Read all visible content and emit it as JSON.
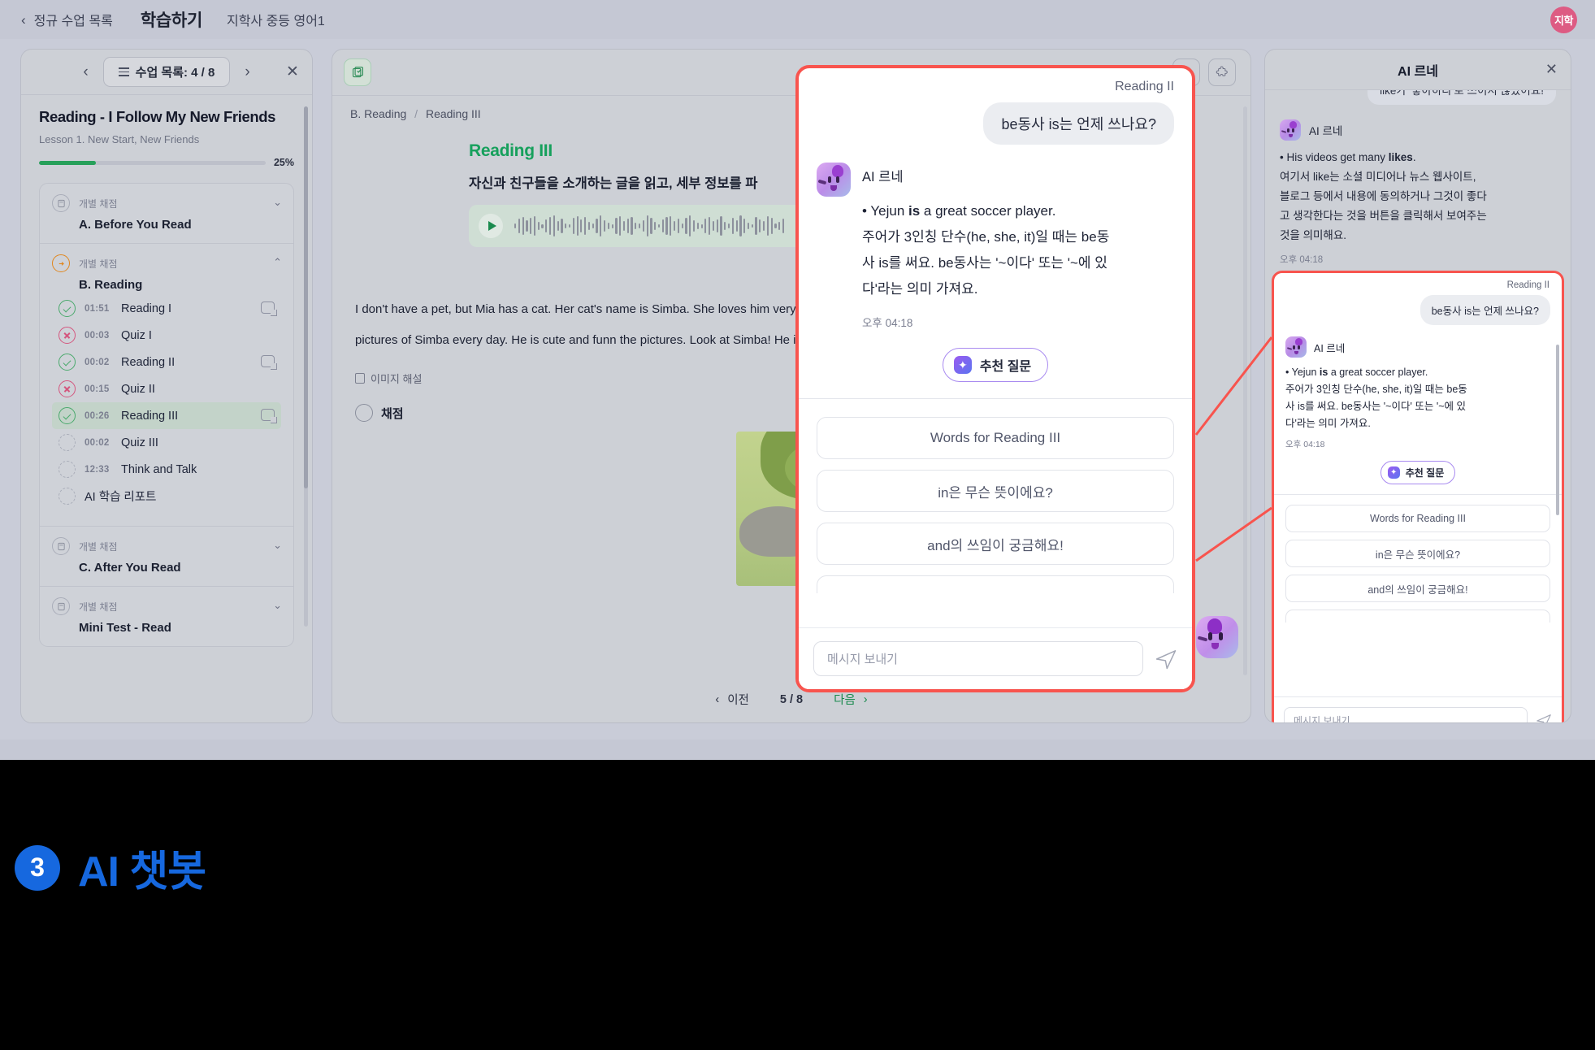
{
  "topbar": {
    "back_label": "정규 수업 목록",
    "back_icon": "chevron-left-icon",
    "title": "학습하기",
    "subtitle": "지학사 중등 영어1",
    "avatar_label": "지학"
  },
  "lesson_panel": {
    "prev_icon": "chevron-left-icon",
    "next_icon": "chevron-right-icon",
    "close_icon": "close-icon",
    "list_chip": "수업 목록: 4 / 8",
    "title": "Reading - I Follow My New Friends",
    "lesson": "Lesson 1. New Start, New Friends",
    "progress_percent": "25%",
    "progress_value": 25,
    "sections": [
      {
        "tag": "개별 채점",
        "name": "A. Before You Read",
        "icon": "clipboard-icon",
        "expanded": false
      },
      {
        "tag": "개별 채점",
        "name": "B. Reading",
        "icon": "arrow-right-circle-icon",
        "expanded": true
      },
      {
        "tag": "개별 채점",
        "name": "C. After You Read",
        "icon": "clipboard-icon",
        "expanded": false
      },
      {
        "tag": "개별 채점",
        "name": "Mini Test - Read",
        "icon": "clipboard-icon",
        "expanded": false
      }
    ],
    "items": [
      {
        "status": "ok",
        "time": "01:51",
        "name": "Reading I",
        "has_bubble": true,
        "selected": false
      },
      {
        "status": "bad",
        "time": "00:03",
        "name": "Quiz I",
        "has_bubble": false,
        "selected": false
      },
      {
        "status": "ok",
        "time": "00:02",
        "name": "Reading II",
        "has_bubble": true,
        "selected": false
      },
      {
        "status": "bad",
        "time": "00:15",
        "name": "Quiz II",
        "has_bubble": false,
        "selected": false
      },
      {
        "status": "ok",
        "time": "00:26",
        "name": "Reading III",
        "has_bubble": true,
        "selected": true
      },
      {
        "status": "none",
        "time": "00:02",
        "name": "Quiz III",
        "has_bubble": false,
        "selected": false
      },
      {
        "status": "none",
        "time": "12:33",
        "name": "Think and Talk",
        "has_bubble": false,
        "selected": false
      },
      {
        "status": "none",
        "time": "",
        "name": "AI 학습 리포트",
        "has_bubble": false,
        "selected": false
      }
    ]
  },
  "content_panel": {
    "book_icon": "book-check-icon",
    "pen_icon": "pen-icon",
    "puzzle_icon": "puzzle-icon",
    "breadcrumb_root": "B. Reading",
    "breadcrumb_sep": "/",
    "breadcrumb_leaf": "Reading III",
    "section_title": "Reading III",
    "section_subtitle": "자신과 친구들을 소개하는 글을 읽고, 세부 정보를 파",
    "play_icon": "play-icon",
    "paragraph": "I don't have a pet, but Mia has a cat. Her cat's name is Simba. She loves him very much. She po pictures of Simba every day. He is cute and funn the pictures. Look at Simba! He is in a box.",
    "image_caption": "이미지 해설",
    "score_label": "채점",
    "pager": {
      "prev": "이전",
      "page": "5 / 8",
      "next": "다음",
      "prev_icon": "chevron-left-icon",
      "next_icon": "chevron-right-icon"
    }
  },
  "chat_panel": {
    "title": "AI 르네",
    "close_icon": "close-icon",
    "clipped_user_message": "like가 '좋아하다'로 쓰이지 않았어요!",
    "messages": [
      {
        "sender": "AI 르네",
        "avatar": "mascot-icon",
        "body": "• His videos get many likes.\n여기서 like는 소셜 미디어나 뉴스 웹사이트, 블로그 등에서 내용에 동의하거나 그것이 좋다고 생각한다는 것을 버튼을 클릭해서 보여주는 것을 의미해요.",
        "time": "오후 04:18"
      }
    ]
  },
  "ai_chat_card": {
    "context_tag": "Reading II",
    "user_message": "be동사 is는 언제 쓰나요?",
    "ai_name": "AI 르네",
    "ai_avatar": "mascot-icon",
    "ai_line_bullet": "• Yejun ",
    "ai_line_bold": "is",
    "ai_line_rest": " a great soccer player.",
    "ai_body_kr": "주어가 3인칭 단수(he, she, it)일 때는 be동사 is를 써요. be동사는 '~이다' 또는 '~에 있다'라는 의미 가져요.",
    "time": "오후 04:18",
    "suggest_label": "추천 질문",
    "suggest_icon": "sparkle-icon",
    "options": [
      "Words for Reading III",
      "in은 무슨 뜻이에요?",
      "and의 쓰임이 궁금해요!"
    ],
    "input_placeholder": "메시지 보내기",
    "send_icon": "send-icon"
  },
  "caption": {
    "number": "3",
    "text": "AI 챗봇"
  },
  "colors": {
    "accent_blue": "#1668df",
    "highlight_red": "#f8544e",
    "green": "#16a05c",
    "avatar_pink": "#dd5b83",
    "purple": "#a98bf0"
  }
}
